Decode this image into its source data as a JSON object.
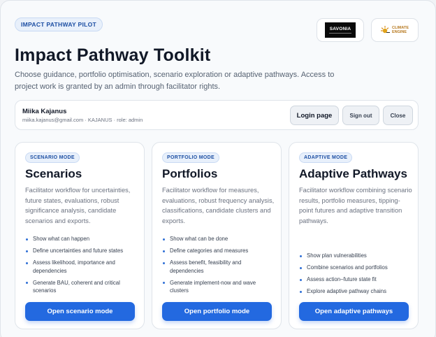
{
  "badge": "IMPACT PATHWAY PILOT",
  "logos": {
    "savonia": "SAVONIA",
    "climate": [
      "CLIMATE",
      "ENGINE"
    ]
  },
  "title": "Impact Pathway Toolkit",
  "intro": "Choose guidance, portfolio optimisation, scenario exploration or adaptive pathways. Access to project work is granted by an admin through facilitator rights.",
  "user": {
    "name": "Miika Kajanus",
    "meta": "miika.kajanus@gmail.com · KAJANUS · role: admin",
    "login_label": "Login page",
    "signout_label": "Sign out",
    "close_label": "Close"
  },
  "cards": [
    {
      "mode": "SCENARIO MODE",
      "title": "Scenarios",
      "description": "Facilitator workflow for uncertainties, future states, evaluations, robust significance analysis, candidate scenarios and exports.",
      "bullets": [
        "Show what can happen",
        "Define uncertainties and future states",
        "Assess likelihood, importance and dependencies",
        "Generate BAU, coherent and critical scenarios"
      ],
      "button": "Open scenario mode"
    },
    {
      "mode": "PORTFOLIO MODE",
      "title": "Portfolios",
      "description": "Facilitator workflow for measures, evaluations, robust frequency analysis, classifications, candidate clusters and exports.",
      "bullets": [
        "Show what can be done",
        "Define categories and measures",
        "Assess benefit, feasibility and dependencies",
        "Generate implement-now and wave clusters"
      ],
      "button": "Open portfolio mode"
    },
    {
      "mode": "ADAPTIVE MODE",
      "title": "Adaptive Pathways",
      "description": "Facilitator workflow combining scenario results, portfolio measures, tipping-point futures and adaptive transition pathways.",
      "bullets": [
        "Show plan vulnerabilities",
        "Combine scenarios and portfolios",
        "Assess action–future state fit",
        "Explore adaptive pathway chains"
      ],
      "button": "Open adaptive pathways"
    }
  ],
  "colors": {
    "accent": "#2369e0",
    "badge_text": "#1d4fa3",
    "bullet": "#2f6fd6"
  }
}
